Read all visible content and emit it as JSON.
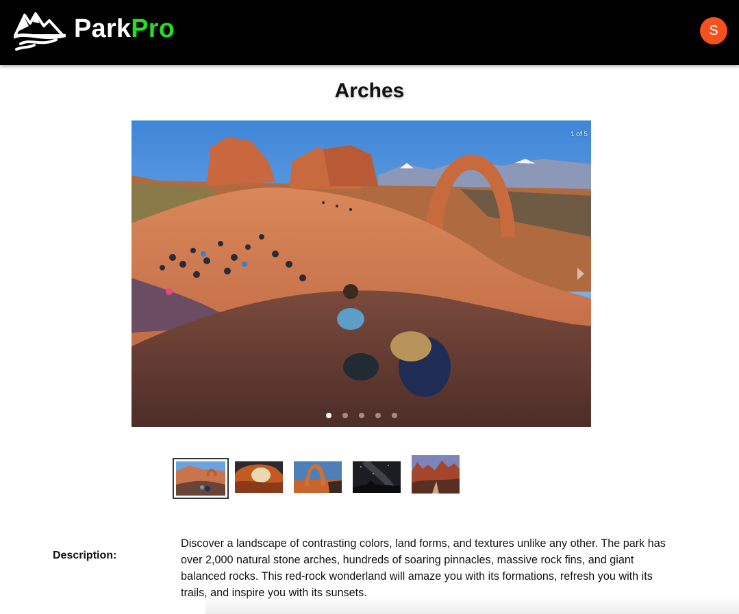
{
  "header": {
    "brand_part1": "Park",
    "brand_part2": "Pro",
    "logo_icon": "mountain-logo-icon",
    "avatar_initial": "S",
    "colors": {
      "background": "#000000",
      "brand_accent": "#22e01a",
      "avatar": "#f4511e"
    }
  },
  "park": {
    "name": "Arches"
  },
  "carousel": {
    "counter": "1 of 5",
    "current_index": 1,
    "total": 5,
    "next_icon": "chevron-right-icon",
    "slides": [
      {
        "subject": "Delicate Arch with hikers"
      },
      {
        "subject": "Window arch at sunset"
      },
      {
        "subject": "Delicate Arch at dusk"
      },
      {
        "subject": "Night sky over arch"
      },
      {
        "subject": "Park Avenue rock formations"
      }
    ]
  },
  "description": {
    "label": "Description:",
    "text": "Discover a landscape of contrasting colors, land forms, and textures unlike any other. The park has over 2,000 natural stone arches, hundreds of soaring pinnacles, massive rock fins, and giant balanced rocks. This red-rock wonderland will amaze you with its formations, refresh you with its trails, and inspire you with its sunsets."
  }
}
